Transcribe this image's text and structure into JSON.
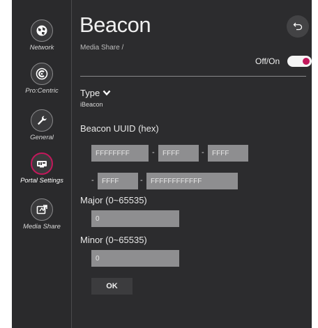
{
  "sidebar": {
    "items": [
      {
        "label": "Network",
        "icon": "globe-icon",
        "active": false
      },
      {
        "label": "Pro:Centric",
        "icon": "procentric-icon",
        "active": false
      },
      {
        "label": "General",
        "icon": "wrench-icon",
        "active": false
      },
      {
        "label": "Portal Settings",
        "icon": "portal-settings-icon",
        "active": true
      },
      {
        "label": "Media Share",
        "icon": "media-share-icon",
        "active": false
      }
    ]
  },
  "header": {
    "title": "Beacon",
    "breadcrumb": "Media Share /",
    "back_icon": "back-icon"
  },
  "power": {
    "label": "Off/On",
    "state": "on"
  },
  "type": {
    "label": "Type",
    "value": "iBeacon"
  },
  "uuid": {
    "label": "Beacon UUID (hex)",
    "segments": [
      "FFFFFFFF",
      "FFFF",
      "FFFF",
      "FFFF",
      "FFFFFFFFFFFF"
    ],
    "separator": "-"
  },
  "major": {
    "label": "Major (0~65535)",
    "value": "0"
  },
  "minor": {
    "label": "Minor (0~65535)",
    "value": "0"
  },
  "actions": {
    "ok_label": "OK"
  },
  "colors": {
    "background": "#2c2c2e",
    "accent": "#c2185b",
    "input": "#8e8e90"
  }
}
